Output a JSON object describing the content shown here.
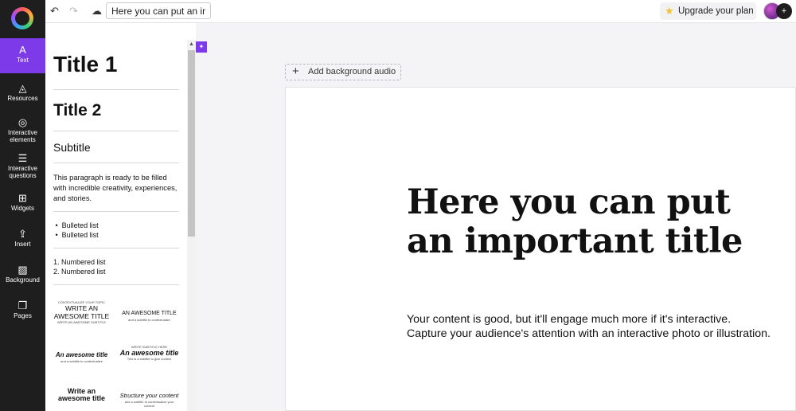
{
  "rail": {
    "items": [
      {
        "label": "Text",
        "icon": "A"
      },
      {
        "label": "Resources",
        "icon": "◬"
      },
      {
        "label": "Interactive elements",
        "icon": "◎"
      },
      {
        "label": "Interactive questions",
        "icon": "☰"
      },
      {
        "label": "Widgets",
        "icon": "⊞"
      },
      {
        "label": "Insert",
        "icon": "⇪"
      },
      {
        "label": "Background",
        "icon": "▨"
      },
      {
        "label": "Pages",
        "icon": "❐"
      }
    ]
  },
  "topbar": {
    "undo_icon": "↶",
    "redo_icon": "↷",
    "cloud_icon": "☁",
    "title_value": "Here you can put an im...",
    "upgrade_label": "Upgrade your plan",
    "upgrade_icon": "★",
    "add_user_icon": "+"
  },
  "panel": {
    "title1": "Title 1",
    "title2": "Title 2",
    "subtitle": "Subtitle",
    "paragraph": "This paragraph is ready to be filled with incredible creativity, experiences, and stories.",
    "bullets": [
      "Bulleted list",
      "Bulleted list"
    ],
    "numbered": [
      "1. Numbered list",
      "2. Numbered list"
    ],
    "templates": [
      {
        "small_top": "CONTEXTUALIZE YOUR TOPIC",
        "big": "WRITE AN AWESOME TITLE",
        "small_bottom": "WRITE AN AWESOME SUBTITLE"
      },
      {
        "small_top": "",
        "big": "AN AWESOME TITLE",
        "small_bottom": "and a subtitle to contextualize"
      },
      {
        "small_top": "",
        "big": "An awesome title",
        "small_bottom": "and a subtitle to contextualize"
      },
      {
        "small_top": "WRITE SUBTITLE HERE",
        "big": "An awesome title",
        "small_bottom": "This is a subtitle to give context"
      },
      {
        "small_top": "",
        "big": "Write an awesome title",
        "small_bottom": ""
      },
      {
        "small_top": "",
        "big": "Structure your content",
        "small_bottom": "and a subtitle to contextualize your content"
      }
    ]
  },
  "canvas": {
    "audio_label": "Add background audio",
    "slide_title": "Here you can put an important title",
    "slide_body_1": "Your content is good, but it'll engage much more if it's interactive.",
    "slide_body_2": "Capture your audience's attention with an interactive photo or illustration."
  },
  "colors": {
    "accent": "#7d3ae8",
    "rail_bg": "#1e1e1e"
  }
}
